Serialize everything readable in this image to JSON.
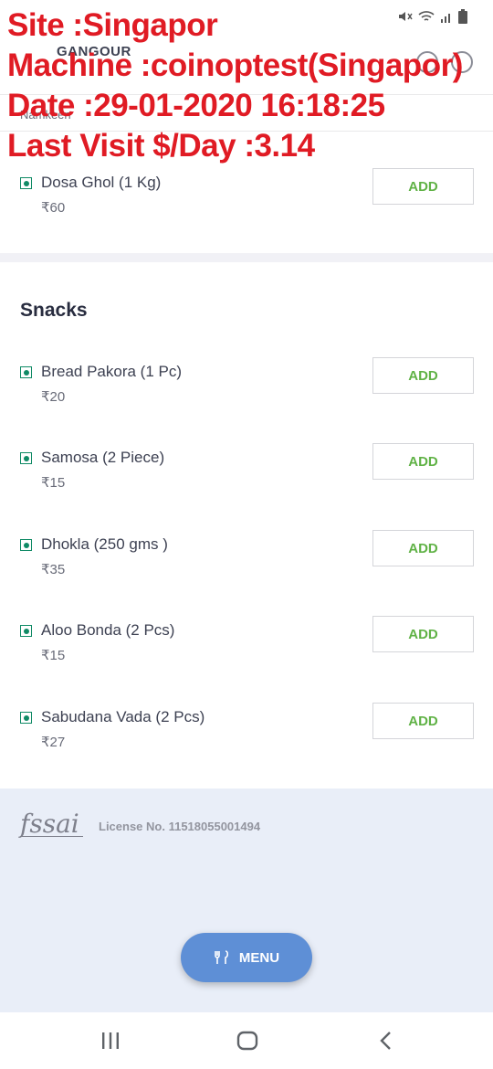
{
  "overlay": {
    "line1": "Site :Singapor",
    "line2": "Machine :coinoptest(Singapor)",
    "line3": "Date :29-01-2020 16:18:25",
    "line4": "Last Visit $/Day :3.14"
  },
  "header": {
    "restaurant_name": "GANGOUR",
    "subnav_label": "Namkeen"
  },
  "colors": {
    "overlay_text": "#e01b24",
    "add_text": "#60b246",
    "veg_mark": "#0f8a65",
    "menu_fab": "#5e8fd6",
    "footer_bg": "#e9eef8"
  },
  "items_top": [
    {
      "name": "Dosa Ghol (1 Kg)",
      "price": "₹60",
      "add_label": "ADD"
    }
  ],
  "snacks": {
    "title": "Snacks",
    "items": [
      {
        "name": "Bread Pakora (1 Pc)",
        "price": "₹20",
        "add_label": "ADD"
      },
      {
        "name": "Samosa (2 Piece)",
        "price": "₹15",
        "add_label": "ADD"
      },
      {
        "name": "Dhokla (250 gms )",
        "price": "₹35",
        "add_label": "ADD"
      },
      {
        "name": "Aloo Bonda (2 Pcs)",
        "price": "₹15",
        "add_label": "ADD"
      },
      {
        "name": "Sabudana Vada (2 Pcs)",
        "price": "₹27",
        "add_label": "ADD"
      }
    ]
  },
  "footer": {
    "logo_text": "fssai",
    "license": "License No. 11518055001494"
  },
  "menu_button": {
    "label": "MENU",
    "icon": "fork-knife-icon"
  }
}
